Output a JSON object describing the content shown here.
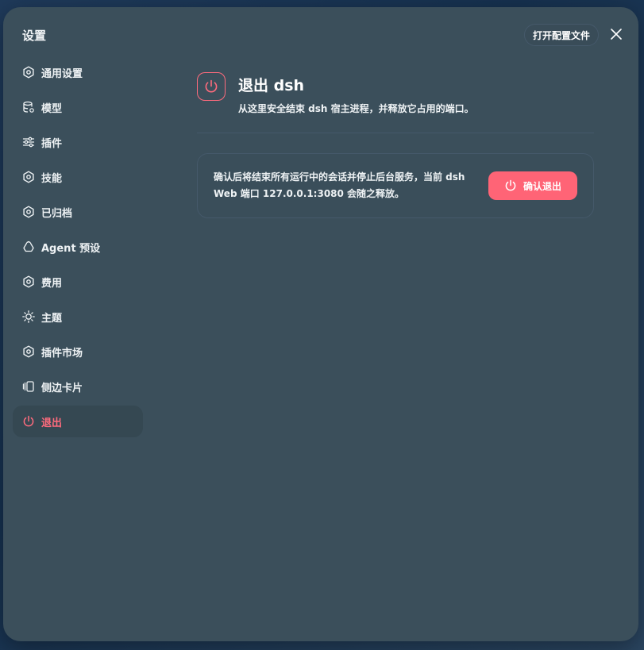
{
  "dialog": {
    "title": "设置",
    "open_config_label": "打开配置文件",
    "close_icon": "close-icon"
  },
  "sidebar": {
    "items": [
      {
        "label": "通用设置",
        "icon": "gear-icon"
      },
      {
        "label": "模型",
        "icon": "database-icon"
      },
      {
        "label": "插件",
        "icon": "sliders-icon"
      },
      {
        "label": "技能",
        "icon": "gear-icon"
      },
      {
        "label": "已归档",
        "icon": "gear-icon"
      },
      {
        "label": "Agent 预设",
        "icon": "recycle-icon"
      },
      {
        "label": "费用",
        "icon": "gear-icon"
      },
      {
        "label": "主题",
        "icon": "sun-icon"
      },
      {
        "label": "插件市场",
        "icon": "gear-icon"
      },
      {
        "label": "侧边卡片",
        "icon": "cards-icon"
      },
      {
        "label": "退出",
        "icon": "power-icon",
        "active": true
      }
    ]
  },
  "main": {
    "title": "退出 dsh",
    "description": "从这里安全结束 dsh 宿主进程，并释放它占用的端口。",
    "card_text": "确认后将结束所有运行中的会话并停止后台服务，当前 dsh Web 端口 127.0.0.1:3080 会随之释放。",
    "confirm_label": "确认退出"
  },
  "colors": {
    "accent": "#ff6476",
    "panel": "#3b4f5b",
    "active_item": "#354852"
  }
}
